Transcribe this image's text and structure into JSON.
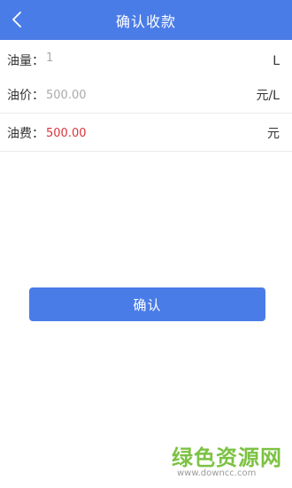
{
  "header": {
    "title": "确认收款",
    "back_icon": "chevron-left-icon"
  },
  "form": {
    "volume": {
      "label": "油量：",
      "value": "1",
      "unit": "L"
    },
    "price": {
      "label": "油价：",
      "value": "500.00",
      "unit": "元/L"
    },
    "cost": {
      "label": "油费：",
      "value": "500.00",
      "unit": "元"
    }
  },
  "actions": {
    "confirm_label": "确认"
  },
  "watermark": {
    "text": "绿色资源网",
    "url": "www.downcc.com"
  },
  "colors": {
    "brand": "#4a7ce8",
    "cost_value": "#d8343a",
    "watermark": "#7cc243"
  }
}
